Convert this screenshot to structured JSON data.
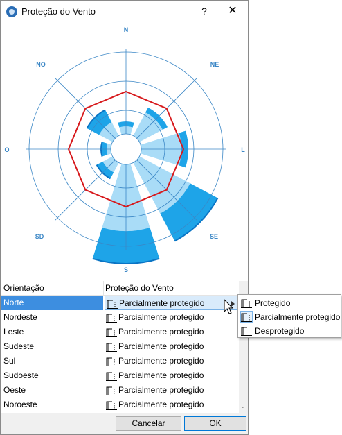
{
  "window": {
    "title": "Proteção do Vento",
    "help_label": "?",
    "close_label": "✕"
  },
  "rose": {
    "directions": [
      "N",
      "NE",
      "L",
      "SE",
      "S",
      "SD",
      "O",
      "NO"
    ],
    "colors": {
      "grid": "#3b87c6",
      "light_fill": "#a9dcf7",
      "mid_fill": "#1ea4e8",
      "dark_fill": "#0a74c4",
      "octagon": "#d7191c"
    }
  },
  "table": {
    "headers": [
      "Orientação",
      "Proteção do Vento"
    ],
    "rows": [
      {
        "orientation": "Norte",
        "protection": "Parcialmente protegido",
        "selected": true
      },
      {
        "orientation": "Nordeste",
        "protection": "Parcialmente protegido"
      },
      {
        "orientation": "Leste",
        "protection": "Parcialmente protegido"
      },
      {
        "orientation": "Sudeste",
        "protection": "Parcialmente protegido"
      },
      {
        "orientation": "Sul",
        "protection": "Parcialmente protegido"
      },
      {
        "orientation": "Sudoeste",
        "protection": "Parcialmente protegido"
      },
      {
        "orientation": "Oeste",
        "protection": "Parcialmente protegido"
      },
      {
        "orientation": "Noroeste",
        "protection": "Parcialmente protegido"
      }
    ]
  },
  "popup": {
    "items": [
      {
        "label": "Protegido",
        "icon": "protected-icon"
      },
      {
        "label": "Parcialmente protegido",
        "icon": "partially-protected-icon",
        "highlighted": true
      },
      {
        "label": "Desprotegido",
        "icon": "unprotected-icon"
      }
    ]
  },
  "footer": {
    "cancel_label": "Cancelar",
    "ok_label": "OK"
  }
}
